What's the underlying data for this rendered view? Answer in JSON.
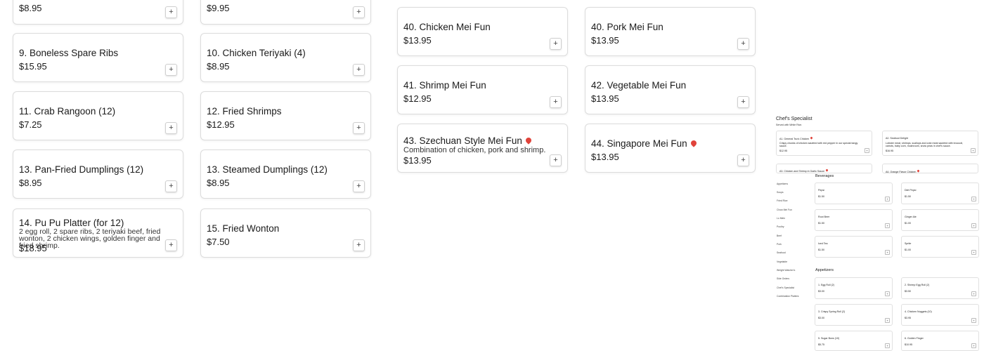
{
  "col1": [
    {
      "title": "",
      "desc": "",
      "price": "$8.95"
    },
    {
      "title": "9. Boneless Spare Ribs",
      "desc": "",
      "price": "$15.95"
    },
    {
      "title": "11. Crab Rangoon (12)",
      "desc": "",
      "price": "$7.25"
    },
    {
      "title": "13. Pan-Fried Dumplings (12)",
      "desc": "",
      "price": "$8.95"
    },
    {
      "title": "14. Pu Pu Platter (for 12)",
      "desc": "2 egg roll, 2 spare ribs, 2 teriyaki beef, fried wonton, 2 chicken wings, golden finger and fried shrimp.",
      "price": "$18.95"
    }
  ],
  "col2": [
    {
      "title": "",
      "desc": "",
      "price": "$9.95"
    },
    {
      "title": "10. Chicken Teriyaki (4)",
      "desc": "",
      "price": "$8.95"
    },
    {
      "title": "12. Fried Shrimps",
      "desc": "",
      "price": "$12.95"
    },
    {
      "title": "13. Steamed Dumplings (12)",
      "desc": "",
      "price": "$8.95"
    },
    {
      "title": "15. Fried Wonton",
      "desc": "",
      "price": "$7.50"
    }
  ],
  "col3": [
    {
      "title": "40. Chicken Mei Fun",
      "desc": "",
      "price": "$13.95",
      "spicy": false
    },
    {
      "title": "41. Shrimp Mei Fun",
      "desc": "",
      "price": "$12.95",
      "spicy": false
    },
    {
      "title": "43. Szechuan Style Mei Fun",
      "desc": "Combination of chicken, pork and shrimp.",
      "price": "$13.95",
      "spicy": true
    }
  ],
  "col4": [
    {
      "title": "40. Pork Mei Fun",
      "desc": "",
      "price": "$13.95",
      "spicy": false
    },
    {
      "title": "42. Vegetable Mei Fun",
      "desc": "",
      "price": "$13.95",
      "spicy": false
    },
    {
      "title": "44. Singapore Mei Fun",
      "desc": "",
      "price": "$13.95",
      "spicy": true
    }
  ],
  "add_label": "+",
  "preview": {
    "chef_title": "Chef's Specialist",
    "chef_sub": "Served with White Rice.",
    "chef_items": [
      {
        "title": "A1. General Tso's Chicken",
        "desc": "Crispy chunks of chicken sautéed with red pepper in our special tangy sauce.",
        "price": "$12.95"
      },
      {
        "title": "A2. Seafood Delight",
        "desc": "Lobster meat, shrimps, scallops and crab meat sautéed with broccoli, carrots, baby corn, mushroom, snow peas in chef's sauce.",
        "price": "$16.95"
      },
      {
        "title": "A3. Chicken and Shrimp in Garlic Sauce",
        "desc": "",
        "price": ""
      },
      {
        "title": "A4. Orange Flavor Chicken",
        "desc": "",
        "price": ""
      }
    ],
    "sidebar": [
      "Appetizers",
      "Soups",
      "Fried Rice",
      "Chow Mei Fun",
      "Lo Mein",
      "Poultry",
      "Beef",
      "Pork",
      "Seafood",
      "Vegetable",
      "Weight Watcher's",
      "Side Orders",
      "Chef's Specialist",
      "Combination Platters"
    ],
    "beverages_title": "Beverages",
    "beverages": [
      {
        "title": "Pepsi",
        "price": "$1.50"
      },
      {
        "title": "Diet Pepsi",
        "price": "$1.50"
      },
      {
        "title": "Root Beer",
        "price": "$1.50"
      },
      {
        "title": "Ginger Ale",
        "price": "$1.00"
      },
      {
        "title": "Iced Tea",
        "price": "$1.50"
      },
      {
        "title": "Sprite",
        "price": "$1.00"
      }
    ],
    "appetizers_title": "Appetizers",
    "appetizers": [
      {
        "title": "1. Egg Roll (2)",
        "price": "$3.00"
      },
      {
        "title": "2. Shrimp Egg Roll (2)",
        "price": "$3.50"
      },
      {
        "title": "3. Crispy Spring Roll (2)",
        "price": "$3.00"
      },
      {
        "title": "4. Chicken Nuggets (10)",
        "price": "$3.95"
      },
      {
        "title": "5. Sugar Buns (10)",
        "price": "$5.75"
      },
      {
        "title": "6. Golden Finger",
        "price": "$10.95"
      }
    ]
  }
}
